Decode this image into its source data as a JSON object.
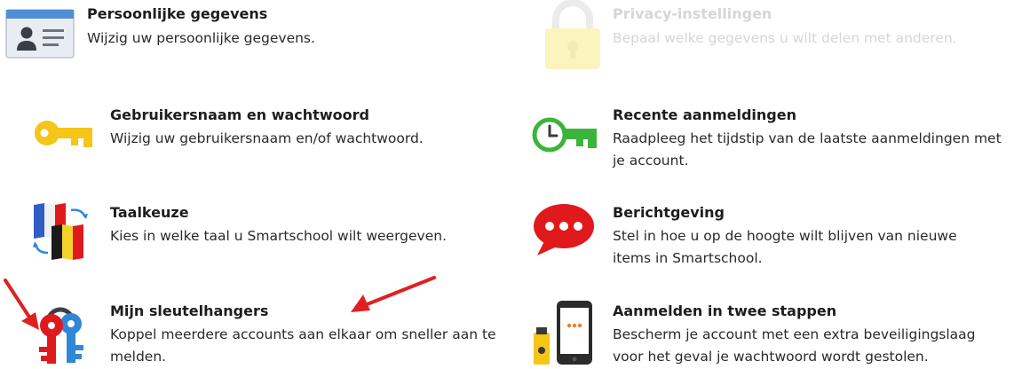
{
  "tiles": [
    {
      "id": "personal",
      "title": "Persoonlijke gegevens",
      "desc": "Wijzig uw persoonlijke gegevens.",
      "icon": "id-card-icon"
    },
    {
      "id": "privacy",
      "title": "Privacy-instellingen",
      "desc": "Bepaal welke gegevens u wilt delen met anderen.",
      "icon": "lock-icon",
      "state": "disabled"
    },
    {
      "id": "password",
      "title": "Gebruikersnaam en wachtwoord",
      "desc": "Wijzig uw gebruikersnaam en/of wachtwoord.",
      "icon": "key-icon"
    },
    {
      "id": "recent",
      "title": "Recente aanmeldingen",
      "desc": "Raadpleeg het tijdstip van de laatste aanmeldingen met je account.",
      "icon": "clock-key-icon"
    },
    {
      "id": "language",
      "title": "Taalkeuze",
      "desc": "Kies in welke taal u Smartschool wilt weergeven.",
      "icon": "flags-icon"
    },
    {
      "id": "notifications",
      "title": "Berichtgeving",
      "desc": "Stel in hoe u op de hoogte wilt blijven van nieuwe items in Smartschool.",
      "icon": "chat-bubble-icon"
    },
    {
      "id": "keychains",
      "title": "Mijn sleutelhangers",
      "desc": "Koppel meerdere accounts aan elkaar om sneller aan te melden.",
      "icon": "keychain-icon"
    },
    {
      "id": "twostep",
      "title": "Aanmelden in twee stappen",
      "desc": "Bescherm je account met een extra beveiligingslaag voor het geval je wachtwoord wordt gestolen.",
      "icon": "phone-usb-icon"
    }
  ],
  "colors": {
    "key_yellow": "#f5c518",
    "green": "#3cb43c",
    "red": "#e0191d",
    "blue": "#2f87d8",
    "annotation_arrow": "#e02020"
  }
}
